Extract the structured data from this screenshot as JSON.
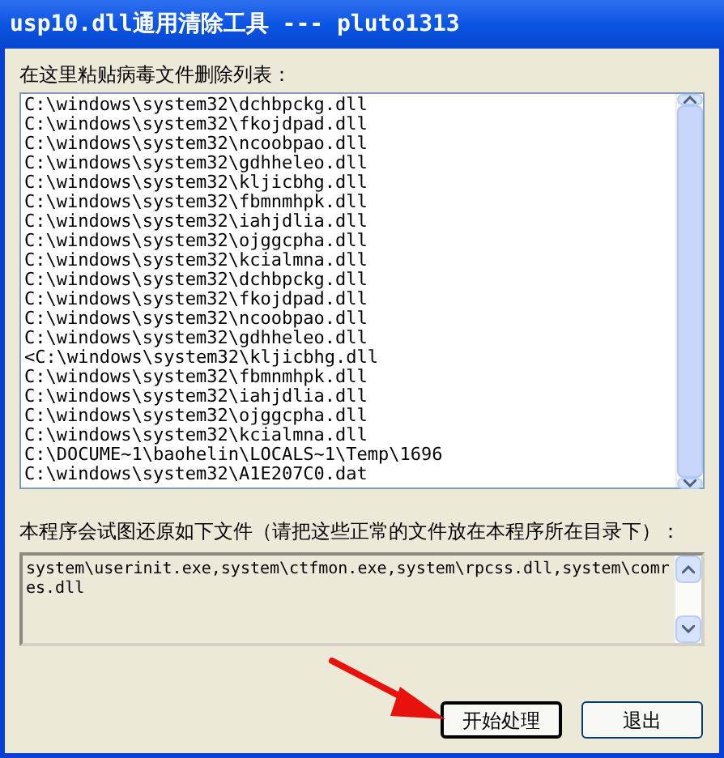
{
  "window": {
    "title": "usp10.dll通用清除工具 --- pluto1313"
  },
  "delete_list": {
    "label": "在这里粘贴病毒文件删除列表：",
    "lines": [
      "C:\\windows\\system32\\dchbpckg.dll",
      "C:\\windows\\system32\\fkojdpad.dll",
      "C:\\windows\\system32\\ncoobpao.dll",
      "C:\\windows\\system32\\gdhheleo.dll",
      "C:\\windows\\system32\\kljicbhg.dll",
      "C:\\windows\\system32\\fbmnmhpk.dll",
      "C:\\windows\\system32\\iahjdlia.dll",
      "C:\\windows\\system32\\ojggcpha.dll",
      "C:\\windows\\system32\\kcialmna.dll",
      "C:\\windows\\system32\\dchbpckg.dll",
      "C:\\windows\\system32\\fkojdpad.dll",
      "C:\\windows\\system32\\ncoobpao.dll",
      "C:\\windows\\system32\\gdhheleo.dll",
      "<C:\\windows\\system32\\kljicbhg.dll",
      "C:\\windows\\system32\\fbmnmhpk.dll",
      "C:\\windows\\system32\\iahjdlia.dll",
      "C:\\windows\\system32\\ojggcpha.dll",
      "C:\\windows\\system32\\kcialmna.dll",
      "C:\\DOCUME~1\\baohelin\\LOCALS~1\\Temp\\1696",
      "C:\\windows\\system32\\A1E207C0.dat"
    ]
  },
  "restore_list": {
    "label": "本程序会试图还原如下文件（请把这些正常的文件放在本程序所在目录下）：",
    "value": "system\\userinit.exe,system\\ctfmon.exe,system\\rpcss.dll,system\\comres.dll"
  },
  "buttons": [
    {
      "label": "开始处理",
      "default": true
    },
    {
      "label": "退出",
      "default": false
    }
  ]
}
